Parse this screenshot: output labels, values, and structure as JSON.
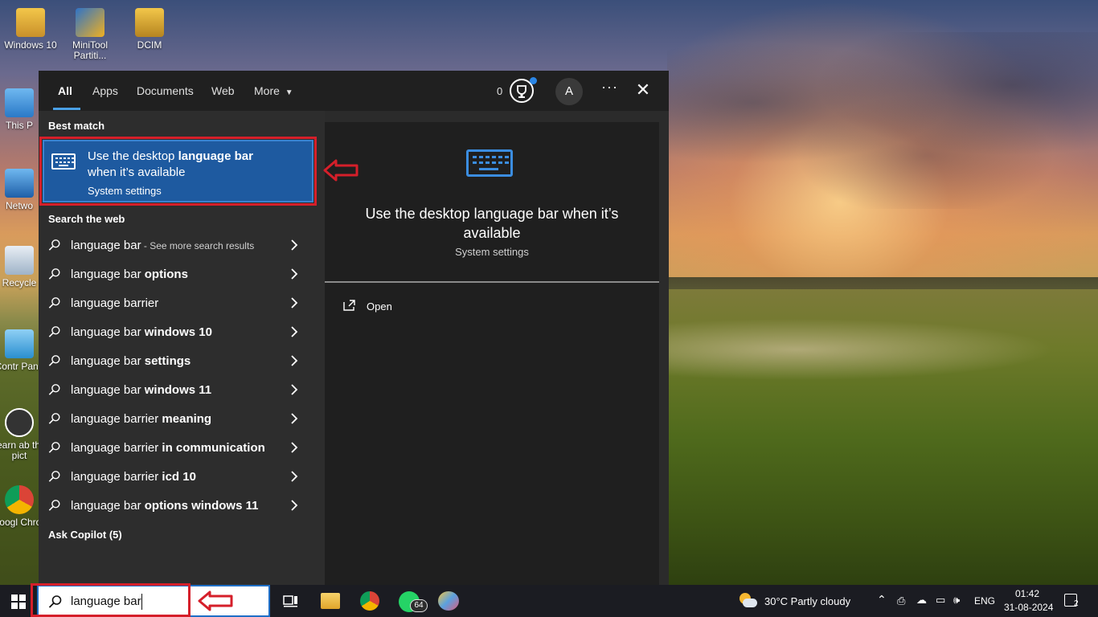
{
  "desktop": {
    "icons": [
      {
        "label": "Windows 10"
      },
      {
        "label": "MiniTool Partiti..."
      },
      {
        "label": "DCIM"
      },
      {
        "label": "This P"
      },
      {
        "label": "Netwo"
      },
      {
        "label": "Recycle"
      },
      {
        "label": "Contr Pane"
      },
      {
        "label": "Learn ab this pict"
      },
      {
        "label": "Googl Chron"
      }
    ]
  },
  "search_panel": {
    "tabs": [
      "All",
      "Apps",
      "Documents",
      "Web",
      "More"
    ],
    "points": "0",
    "avatar_letter": "A",
    "best_match_label": "Best match",
    "best_match": {
      "title_prefix": "Use the desktop ",
      "title_bold": "language bar",
      "title_suffix": "when it’s available",
      "subtitle": "System settings"
    },
    "search_web_label": "Search the web",
    "web_results": [
      {
        "plain": "language bar",
        "bold": "",
        "suffix": " - See more search results"
      },
      {
        "plain": "language bar ",
        "bold": "options",
        "suffix": ""
      },
      {
        "plain": "language barrier",
        "bold": "",
        "suffix": ""
      },
      {
        "plain": "language bar ",
        "bold": "windows 10",
        "suffix": ""
      },
      {
        "plain": "language bar ",
        "bold": "settings",
        "suffix": ""
      },
      {
        "plain": "language bar ",
        "bold": "windows 11",
        "suffix": ""
      },
      {
        "plain": "language barrier ",
        "bold": "meaning",
        "suffix": ""
      },
      {
        "plain": "language barrier ",
        "bold": "in communication",
        "suffix": ""
      },
      {
        "plain": "language barrier ",
        "bold": "icd 10",
        "suffix": ""
      },
      {
        "plain": "language bar ",
        "bold": "options windows 11",
        "suffix": ""
      }
    ],
    "ask_copilot_label": "Ask Copilot (5)",
    "preview": {
      "title": "Use the desktop language bar when it’s available",
      "subtitle": "System settings",
      "open_label": "Open"
    }
  },
  "taskbar": {
    "search_query": "language bar",
    "whatsapp_badge": "64",
    "weather": "30°C  Partly cloudy",
    "language": "ENG",
    "time": "01:42",
    "date": "31-08-2024",
    "notifications": "2"
  },
  "colors": {
    "accent": "#1e5aa0",
    "highlight_red": "#d51f2a",
    "panel": "#2b2b2b"
  }
}
